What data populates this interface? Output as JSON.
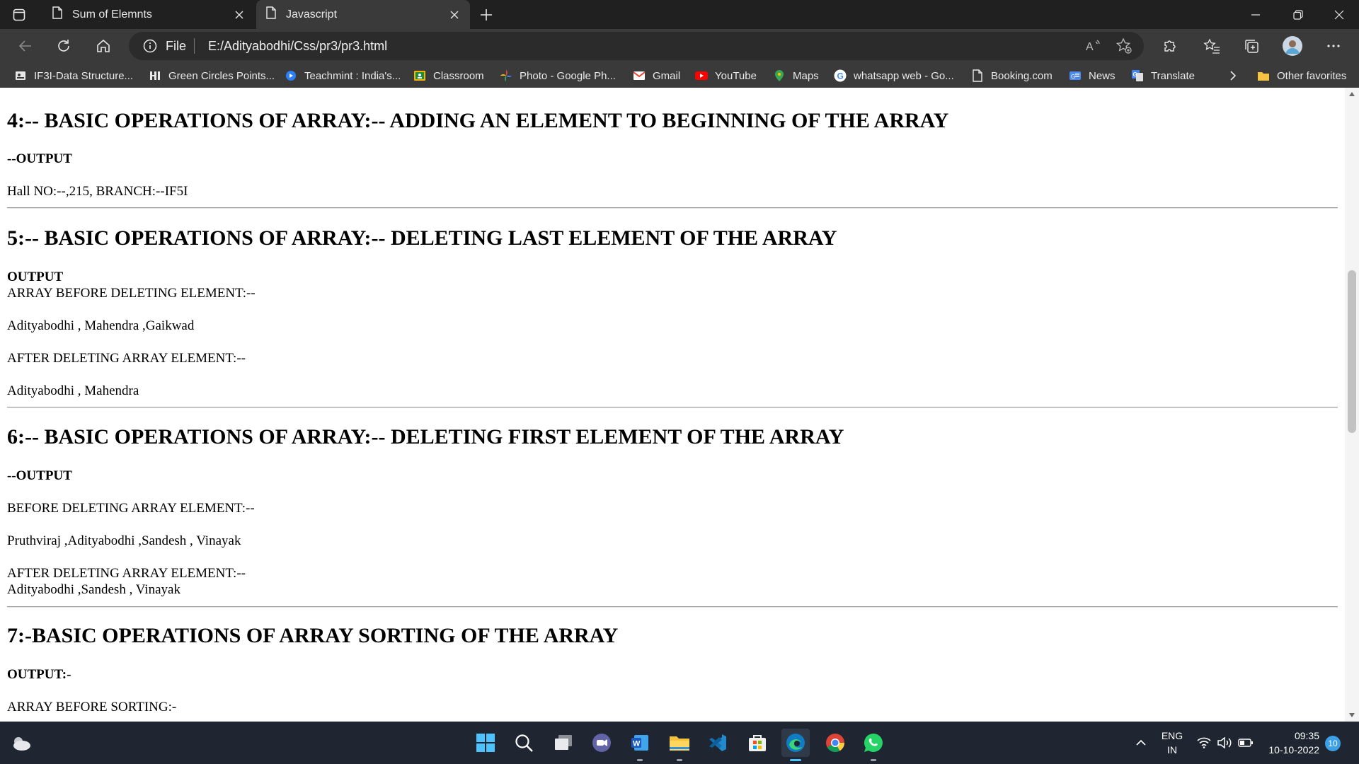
{
  "browser": {
    "tabs": [
      {
        "title": "Sum of Elemnts"
      },
      {
        "title": "Javascript"
      }
    ],
    "address": {
      "security_label": "File",
      "url": "E:/Adityabodhi/Css/pr3/pr3.html"
    },
    "favorites": [
      {
        "label": "IF3I-Data Structure...",
        "icon": "document-icon"
      },
      {
        "label": "Green Circles Points...",
        "icon": "hi-icon"
      },
      {
        "label": "Teachmint : India's...",
        "icon": "teachmint-icon"
      },
      {
        "label": "Classroom",
        "icon": "classroom-icon"
      },
      {
        "label": "Photo - Google Ph...",
        "icon": "google-photos-icon"
      },
      {
        "label": "Gmail",
        "icon": "gmail-icon"
      },
      {
        "label": "YouTube",
        "icon": "youtube-icon"
      },
      {
        "label": "Maps",
        "icon": "maps-icon"
      },
      {
        "label": "whatsapp web - Go...",
        "icon": "google-icon"
      },
      {
        "label": "Booking.com",
        "icon": "page-icon"
      },
      {
        "label": "News",
        "icon": "news-icon"
      },
      {
        "label": "Translate",
        "icon": "translate-icon"
      }
    ],
    "other_favorites": "Other favorites"
  },
  "page": {
    "s4": {
      "heading": "4:-- BASIC OPERATIONS OF ARRAY:-- ADDING AN ELEMENT TO BEGINNING OF THE ARRAY",
      "output_label": "--OUTPUT",
      "line1": "Hall NO:--,215, BRANCH:--IF5I"
    },
    "s5": {
      "heading": "5:-- BASIC OPERATIONS OF ARRAY:-- DELETING LAST ELEMENT OF THE ARRAY",
      "output_label": "OUTPUT",
      "line1": "ARRAY BEFORE DELETING ELEMENT:--",
      "line2": "Adityabodhi , Mahendra ,Gaikwad",
      "line3": "AFTER DELETING ARRAY ELEMENT:--",
      "line4": "Adityabodhi , Mahendra"
    },
    "s6": {
      "heading": "6:-- BASIC OPERATIONS OF ARRAY:-- DELETING FIRST ELEMENT OF THE ARRAY",
      "output_label": "--OUTPUT",
      "line1": "BEFORE DELETING ARRAY ELEMENT:--",
      "line2": "Pruthviraj ,Adityabodhi ,Sandesh , Vinayak",
      "line3": "AFTER DELETING ARRAY ELEMENT:--",
      "line4": "Adityabodhi ,Sandesh , Vinayak"
    },
    "s7": {
      "heading": "7:-BASIC OPERATIONS OF ARRAY SORTING OF THE ARRAY",
      "output_label": "OUTPUT:-",
      "line1": "ARRAY BEFORE SORTING:-"
    }
  },
  "taskbar": {
    "apps": [
      "start-icon",
      "search-icon",
      "task-view-icon",
      "teams-chat-icon",
      "word-icon",
      "file-explorer-icon",
      "vscode-icon",
      "microsoft-store-icon",
      "edge-icon",
      "chrome-icon",
      "whatsapp-icon"
    ],
    "language_line1": "ENG",
    "language_line2": "IN",
    "time": "09:35",
    "date": "10-10-2022",
    "notification_count": "10"
  },
  "colors": {
    "titlebar": "#202020",
    "toolbar": "#3a3a3a",
    "taskbar": "#1f2632",
    "accent": "#4cc2ff"
  }
}
